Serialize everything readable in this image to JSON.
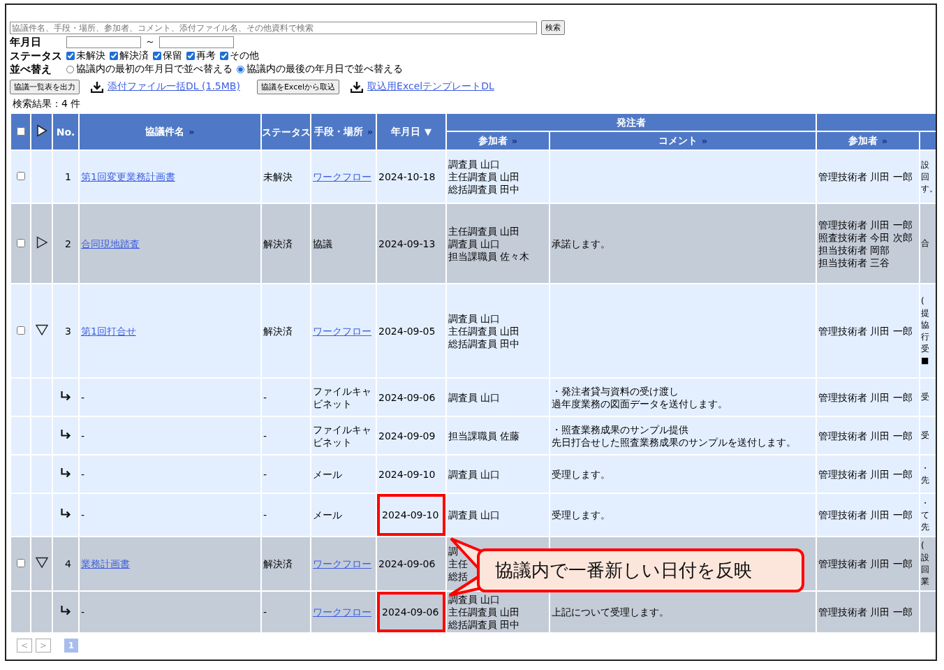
{
  "search": {
    "placeholder": "協議件名、手段・場所、参加者、コメント、添付ファイル名、その他資料で検索",
    "button": "検索"
  },
  "date_filter": {
    "label": "年月日",
    "separator": "～"
  },
  "status_filter": {
    "label": "ステータス",
    "options": [
      {
        "label": "未解決",
        "checked": true
      },
      {
        "label": "解決済",
        "checked": true
      },
      {
        "label": "保留",
        "checked": true
      },
      {
        "label": "再考",
        "checked": true
      },
      {
        "label": "その他",
        "checked": true
      }
    ]
  },
  "sort": {
    "label": "並べ替え",
    "options": [
      {
        "label": "協議内の最初の年月日で並べ替える",
        "selected": false
      },
      {
        "label": "協議内の最後の年月日で並べ替える",
        "selected": true
      }
    ]
  },
  "actions": [
    {
      "kind": "button",
      "label": "協議一覧表を出力"
    },
    {
      "kind": "download",
      "label": "添付ファイル一括DL (1.5MB)"
    },
    {
      "kind": "button",
      "label": "協議をExcelから取込"
    },
    {
      "kind": "download",
      "label": "取込用ExcelテンプレートDL"
    }
  ],
  "result_count": "検索結果：4 件",
  "table": {
    "select_all": {
      "checked": false
    },
    "columns": [
      {
        "label": "No."
      },
      {
        "label": "協議件名",
        "mark": "»",
        "sorted": false
      },
      {
        "label": "ステータス"
      },
      {
        "label": "手段・場所",
        "mark": "»",
        "sorted": false
      },
      {
        "label": "年月日",
        "mark": "▼",
        "sorted": true
      }
    ],
    "header_groups": [
      {
        "label": "発注者",
        "columns": [
          {
            "label": "参加者",
            "mark": "»",
            "sorted": false
          },
          {
            "label": "コメント",
            "mark": "»",
            "sorted": false
          }
        ]
      },
      {
        "columns": [
          {
            "label": "参加者",
            "mark": "»",
            "sorted": false
          }
        ]
      }
    ],
    "rows": [
      {
        "kind": "parent",
        "checked": false,
        "shaded": false,
        "highlighted": false,
        "no": "1",
        "title": "第1回変更業務計画書",
        "status": "未解決",
        "means": {
          "text": "ワークフロー",
          "link": true
        },
        "date": "2024-10-18",
        "participants": [
          "調査員 山口",
          "主任調査員 山田",
          "総括調査員 田中"
        ],
        "participants_2": [
          "管理技術者 川田 一郎"
        ],
        "column_11": [
          "設",
          "回",
          "す。"
        ]
      },
      {
        "kind": "parent",
        "checked": false,
        "expanded": false,
        "shaded": true,
        "highlighted": false,
        "no": "2",
        "title": "合同現地踏査",
        "status": "解決済",
        "means": {
          "text": "協議",
          "link": false
        },
        "date": "2024-09-13",
        "participants": [
          "主任調査員 山田",
          "調査員 山口",
          "担当課職員 佐々木"
        ],
        "comment": [
          "承諾します。"
        ],
        "participants_2": [
          "管理技術者 川田 一郎",
          "照査技術者 今田 次郎",
          "担当技術者 岡部",
          "担当技術者 三谷"
        ],
        "column_11": [
          "合"
        ]
      },
      {
        "kind": "parent",
        "checked": false,
        "expanded": true,
        "shaded": false,
        "highlighted": false,
        "no": "3",
        "title": "第1回打合せ",
        "status": "解決済",
        "means": {
          "text": "ワークフロー",
          "link": true
        },
        "date": "2024-09-05",
        "participants": [
          "調査員 山口",
          "主任調査員 山田",
          "総括調査員 田中"
        ],
        "participants_2": [
          "管理技術者 川田 一郎"
        ],
        "column_11": [
          "(",
          "提",
          "協",
          "行",
          "受",
          "■"
        ]
      },
      {
        "kind": "reply",
        "shaded": false,
        "highlighted": false,
        "title": "-",
        "status": "-",
        "means": {
          "text": "ファイルキャビネット",
          "link": false
        },
        "date": "2024-09-06",
        "participants": [
          "調査員 山口"
        ],
        "comment": [
          "・発注者貸与資料の受け渡し",
          "過年度業務の図面データを送付します。"
        ],
        "participants_2": [
          "管理技術者 川田 一郎"
        ],
        "column_11": [
          "受"
        ]
      },
      {
        "kind": "reply",
        "shaded": false,
        "highlighted": false,
        "title": "-",
        "status": "-",
        "means": {
          "text": "ファイルキャビネット",
          "link": false
        },
        "date": "2024-09-09",
        "participants": [
          "担当課職員 佐藤"
        ],
        "comment": [
          "・照査業務成果のサンプル提供",
          "先日打合せした照査業務成果のサンプルを送付します。"
        ],
        "participants_2": [
          "管理技術者 川田 一郎"
        ],
        "column_11": [
          "受"
        ]
      },
      {
        "kind": "reply",
        "shaded": false,
        "highlighted": false,
        "title": "-",
        "status": "-",
        "means": {
          "text": "メール",
          "link": false
        },
        "date": "2024-09-10",
        "participants": [
          "調査員 山口"
        ],
        "comment": [
          "受理します。"
        ],
        "participants_2": [
          "管理技術者 川田 一郎"
        ],
        "column_11": [
          "・",
          "先"
        ]
      },
      {
        "kind": "reply",
        "shaded": false,
        "highlighted": true,
        "title": "-",
        "status": "-",
        "means": {
          "text": "メール",
          "link": false
        },
        "date": "2024-09-10",
        "participants": [
          "調査員 山口"
        ],
        "comment": [
          "受理します。"
        ],
        "participants_2": [
          "管理技術者 川田 一郎"
        ],
        "column_11": [
          "・",
          "て",
          "先"
        ]
      },
      {
        "kind": "parent",
        "checked": false,
        "expanded": true,
        "shaded": true,
        "highlighted": false,
        "no": "4",
        "title": "業務計画書",
        "status": "解決済",
        "means": {
          "text": "ワークフロー",
          "link": true
        },
        "date": "2024-09-06",
        "participants": [
          "調",
          "主任",
          "総括"
        ],
        "participants_2": [
          "管理技術者 川田 一郎"
        ],
        "column_11": [
          "(",
          "設",
          "回",
          "業"
        ]
      },
      {
        "kind": "reply",
        "shaded": true,
        "highlighted": true,
        "title": "-",
        "status": "-",
        "means": {
          "text": "ワークフロー",
          "link": true
        },
        "date": "2024-09-06",
        "participants": [
          "調査員 山口",
          "主任調査員 山田",
          "総括調査員 田中"
        ],
        "comment": [
          "上記について受理します。"
        ],
        "participants_2": [
          "管理技術者 川田 一郎"
        ]
      }
    ]
  },
  "callout": {
    "text": "協議内で一番新しい日付を反映"
  },
  "pager": {
    "prev": "<",
    "next": ">",
    "pages": [
      {
        "label": "1",
        "selected": true
      }
    ]
  }
}
